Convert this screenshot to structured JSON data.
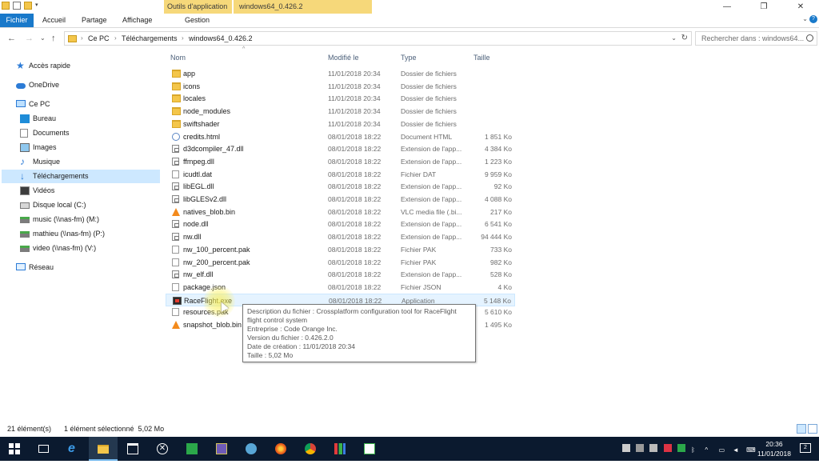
{
  "ribbon": {
    "tabs": [
      "Fichier",
      "Accueil",
      "Partage",
      "Affichage",
      "Gestion"
    ],
    "context_tab": "Outils d'application",
    "window_title": "windows64_0.426.2"
  },
  "address": {
    "crumbs": [
      "Ce PC",
      "Téléchargements",
      "windows64_0.426.2"
    ],
    "search_placeholder": "Rechercher dans : windows64..."
  },
  "nav": [
    {
      "label": "Accès rapide",
      "icon": "star-icon"
    },
    {
      "label": "OneDrive",
      "icon": "cloud-icon"
    },
    {
      "label": "Ce PC",
      "icon": "computer-icon"
    },
    {
      "label": "Bureau",
      "icon": "desktop-icon"
    },
    {
      "label": "Documents",
      "icon": "documents-icon"
    },
    {
      "label": "Images",
      "icon": "pictures-icon"
    },
    {
      "label": "Musique",
      "icon": "music-icon"
    },
    {
      "label": "Téléchargements",
      "icon": "downloads-icon"
    },
    {
      "label": "Vidéos",
      "icon": "videos-icon"
    },
    {
      "label": "Disque local (C:)",
      "icon": "drive-icon"
    },
    {
      "label": "music (\\\\nas-fm) (M:)",
      "icon": "network-drive-icon"
    },
    {
      "label": "mathieu (\\\\nas-fm) (P:)",
      "icon": "network-drive-icon"
    },
    {
      "label": "video (\\\\nas-fm) (V:)",
      "icon": "network-drive-icon"
    },
    {
      "label": "Réseau",
      "icon": "network-icon"
    }
  ],
  "columns": {
    "name": "Nom",
    "modified": "Modifié le",
    "type": "Type",
    "size": "Taille"
  },
  "files": [
    {
      "name": "app",
      "date": "11/01/2018 20:34",
      "type": "Dossier de fichiers",
      "size": "",
      "icon": "folder-icon"
    },
    {
      "name": "icons",
      "date": "11/01/2018 20:34",
      "type": "Dossier de fichiers",
      "size": "",
      "icon": "folder-icon"
    },
    {
      "name": "locales",
      "date": "11/01/2018 20:34",
      "type": "Dossier de fichiers",
      "size": "",
      "icon": "folder-icon"
    },
    {
      "name": "node_modules",
      "date": "11/01/2018 20:34",
      "type": "Dossier de fichiers",
      "size": "",
      "icon": "folder-icon"
    },
    {
      "name": "swiftshader",
      "date": "11/01/2018 20:34",
      "type": "Dossier de fichiers",
      "size": "",
      "icon": "folder-icon"
    },
    {
      "name": "credits.html",
      "date": "08/01/2018 18:22",
      "type": "Document HTML",
      "size": "1 851 Ko",
      "icon": "html-file-icon"
    },
    {
      "name": "d3dcompiler_47.dll",
      "date": "08/01/2018 18:22",
      "type": "Extension de l'app...",
      "size": "4 384 Ko",
      "icon": "dll-file-icon"
    },
    {
      "name": "ffmpeg.dll",
      "date": "08/01/2018 18:22",
      "type": "Extension de l'app...",
      "size": "1 223 Ko",
      "icon": "dll-file-icon"
    },
    {
      "name": "icudtl.dat",
      "date": "08/01/2018 18:22",
      "type": "Fichier DAT",
      "size": "9 959 Ko",
      "icon": "file-icon"
    },
    {
      "name": "libEGL.dll",
      "date": "08/01/2018 18:22",
      "type": "Extension de l'app...",
      "size": "92 Ko",
      "icon": "dll-file-icon"
    },
    {
      "name": "libGLESv2.dll",
      "date": "08/01/2018 18:22",
      "type": "Extension de l'app...",
      "size": "4 088 Ko",
      "icon": "dll-file-icon"
    },
    {
      "name": "natives_blob.bin",
      "date": "08/01/2018 18:22",
      "type": "VLC media file (.bi...",
      "size": "217 Ko",
      "icon": "vlc-icon"
    },
    {
      "name": "node.dll",
      "date": "08/01/2018 18:22",
      "type": "Extension de l'app...",
      "size": "6 541 Ko",
      "icon": "dll-file-icon"
    },
    {
      "name": "nw.dll",
      "date": "08/01/2018 18:22",
      "type": "Extension de l'app...",
      "size": "94 444 Ko",
      "icon": "dll-file-icon"
    },
    {
      "name": "nw_100_percent.pak",
      "date": "08/01/2018 18:22",
      "type": "Fichier PAK",
      "size": "733 Ko",
      "icon": "file-icon"
    },
    {
      "name": "nw_200_percent.pak",
      "date": "08/01/2018 18:22",
      "type": "Fichier PAK",
      "size": "982 Ko",
      "icon": "file-icon"
    },
    {
      "name": "nw_elf.dll",
      "date": "08/01/2018 18:22",
      "type": "Extension de l'app...",
      "size": "528 Ko",
      "icon": "dll-file-icon"
    },
    {
      "name": "package.json",
      "date": "08/01/2018 18:22",
      "type": "Fichier JSON",
      "size": "4 Ko",
      "icon": "file-icon"
    },
    {
      "name": "RaceFlight.exe",
      "date": "08/01/2018 18:22",
      "type": "Application",
      "size": "5 148 Ko",
      "icon": "exe-icon"
    },
    {
      "name": "resources.pak",
      "date": "",
      "type": "",
      "size": "5 610 Ko",
      "icon": "file-icon"
    },
    {
      "name": "snapshot_blob.bin",
      "date": "",
      "type": "",
      "size": "1 495 Ko",
      "icon": "vlc-icon"
    }
  ],
  "tooltip": [
    "Description du fichier : Crossplatform configuration tool for RaceFlight",
    "flight control system",
    "Entreprise : Code Orange Inc.",
    "Version du fichier : 0.426.2.0",
    "Date de création : 11/01/2018 20:34",
    "Taille : 5,02 Mo"
  ],
  "status": {
    "count": "21 élément(s)",
    "selection": "1 élément sélectionné  5,02 Mo"
  },
  "taskbar": {
    "time": "20:36",
    "date": "11/01/2018",
    "notifications": "2"
  }
}
